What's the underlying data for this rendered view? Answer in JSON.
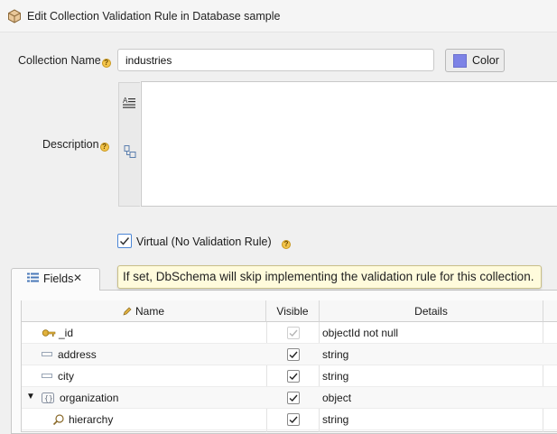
{
  "window": {
    "title": "Edit Collection Validation Rule in Database sample"
  },
  "form": {
    "collection_name_label": "Collection Name",
    "collection_name_value": "industries",
    "color_button_label": "Color",
    "color_value": "#7d83e6",
    "description_label": "Description",
    "description_value": "",
    "virtual_checkbox_label": "Virtual (No Validation Rule)",
    "virtual_checked": true,
    "help_glyph": "?"
  },
  "tooltip": {
    "text": "If set, DbSchema will skip implementing the validation rule for this collection."
  },
  "tabs": [
    {
      "label": "Fields",
      "close": "✕",
      "icon": "fields-list-icon"
    }
  ],
  "table": {
    "columns": {
      "name": "Name",
      "visible": "Visible",
      "details": "Details"
    },
    "rows": [
      {
        "name": "_id",
        "icon": "key-icon",
        "visible": true,
        "visible_disabled": true,
        "details": "objectId not null"
      },
      {
        "name": "address",
        "icon": "field-icon",
        "visible": true,
        "details": "string"
      },
      {
        "name": "city",
        "icon": "field-icon",
        "visible": true,
        "details": "string"
      },
      {
        "name": "organization",
        "icon": "object-icon",
        "expand": "▼",
        "visible": true,
        "details": "object"
      },
      {
        "name": "hierarchy",
        "icon": "search-field-icon",
        "visible": true,
        "details": "string"
      }
    ]
  },
  "colors": {
    "accent": "#4c86d6",
    "tooltip_bg": "#fffbdc"
  }
}
